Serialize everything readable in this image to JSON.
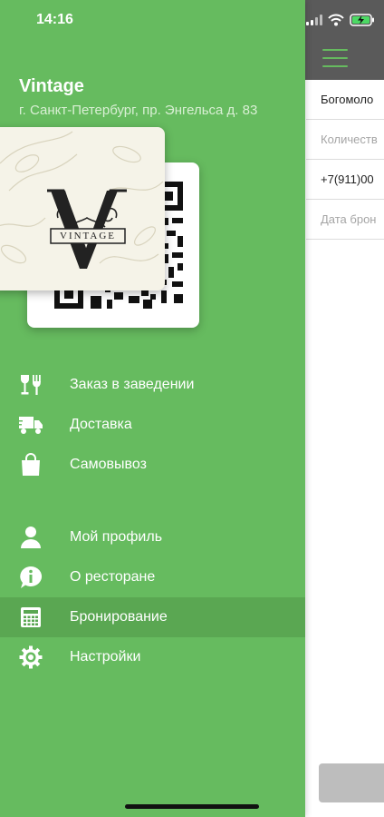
{
  "status_bar": {
    "time": "14:16"
  },
  "background_screen": {
    "fields": [
      {
        "value": "Богомоло",
        "kind": "value"
      },
      {
        "value": "Количеств",
        "kind": "placeholder"
      },
      {
        "value": "+7(911)00",
        "kind": "value"
      },
      {
        "value": "Дата брон",
        "kind": "placeholder"
      }
    ]
  },
  "drawer": {
    "venue_name": "Vintage",
    "venue_address": "г. Санкт-Петербург, пр. Энгельса д. 83",
    "card_logo_text": "VINTAGE",
    "menu_groups": [
      [
        {
          "label": "Заказ в заведении",
          "icon": "wine-fork-icon"
        },
        {
          "label": "Доставка",
          "icon": "delivery-truck-icon"
        },
        {
          "label": "Самовывоз",
          "icon": "shopping-bag-icon"
        }
      ],
      [
        {
          "label": "Мой профиль",
          "icon": "user-icon"
        },
        {
          "label": "О ресторане",
          "icon": "info-bubble-icon"
        },
        {
          "label": "Бронирование",
          "icon": "calculator-icon",
          "active": true
        },
        {
          "label": "Настройки",
          "icon": "gear-icon"
        }
      ]
    ]
  },
  "colors": {
    "drawer_bg": "#66bb5f",
    "active_item_bg": "#5aa752",
    "topbar_bg": "#5a5a5a"
  }
}
